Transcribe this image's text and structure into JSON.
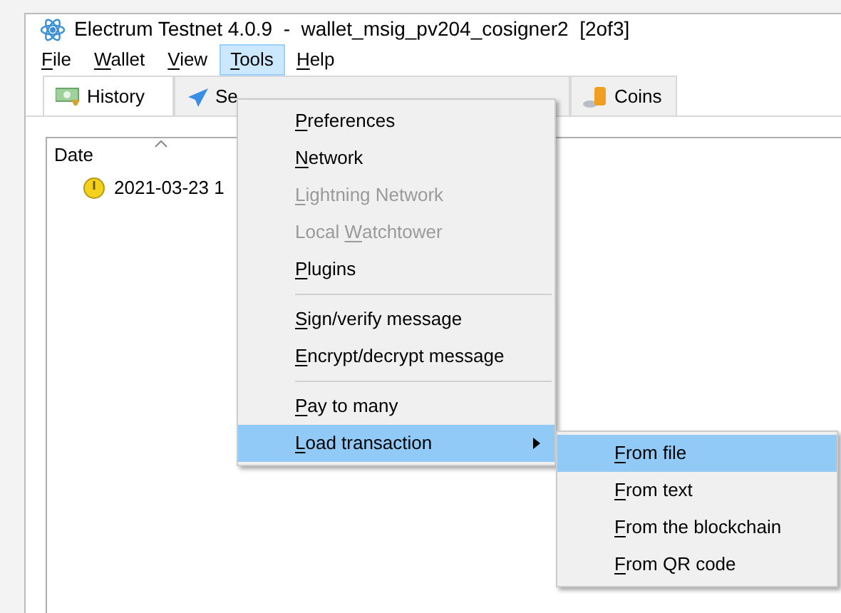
{
  "window": {
    "title": "Electrum Testnet 4.0.9  -  wallet_msig_pv204_cosigner2  [2of3]"
  },
  "menu_bar": [
    {
      "key": "F",
      "post": "ile",
      "selected": false
    },
    {
      "key": "W",
      "post": "allet",
      "selected": false
    },
    {
      "key": "V",
      "post": "iew",
      "selected": false
    },
    {
      "key": "T",
      "post": "ools",
      "selected": true
    },
    {
      "key": "H",
      "post": "elp",
      "selected": false
    }
  ],
  "tabs": [
    {
      "label": "History",
      "kind": "history",
      "selected": true
    },
    {
      "label": "Se",
      "kind": "send",
      "selected": false
    },
    {
      "label": "Coins",
      "kind": "coins",
      "selected": false
    }
  ],
  "history": {
    "columns": [
      "Date"
    ],
    "rows": [
      {
        "date": "2021-03-23 1"
      }
    ]
  },
  "tools_menu": [
    {
      "kind": "item",
      "key": "P",
      "post": "references",
      "disabled": false,
      "selected": false
    },
    {
      "kind": "item",
      "key": "N",
      "post": "etwork",
      "disabled": false,
      "selected": false
    },
    {
      "kind": "item",
      "key": "L",
      "post": "ightning Network",
      "disabled": true,
      "selected": false
    },
    {
      "kind": "item",
      "pre": "Local ",
      "key": "W",
      "post": "atchtower",
      "disabled": true,
      "selected": false
    },
    {
      "kind": "item",
      "key": "P",
      "post": "lugins",
      "disabled": false,
      "selected": false
    },
    {
      "kind": "separator"
    },
    {
      "kind": "item",
      "key": "S",
      "post": "ign/verify message",
      "disabled": false,
      "selected": false
    },
    {
      "kind": "item",
      "key": "E",
      "post": "ncrypt/decrypt message",
      "disabled": false,
      "selected": false
    },
    {
      "kind": "separator"
    },
    {
      "kind": "item",
      "key": "P",
      "post": "ay to many",
      "disabled": false,
      "selected": false
    },
    {
      "kind": "submenu",
      "key": "L",
      "post": "oad transaction",
      "disabled": false,
      "selected": true
    }
  ],
  "load_submenu": [
    {
      "key": "F",
      "post": "rom file",
      "selected": true
    },
    {
      "key": "F",
      "post": "rom text",
      "selected": false
    },
    {
      "key": "F",
      "post": "rom the blockchain",
      "selected": false
    },
    {
      "key": "F",
      "post": "rom QR code",
      "selected": false
    }
  ]
}
